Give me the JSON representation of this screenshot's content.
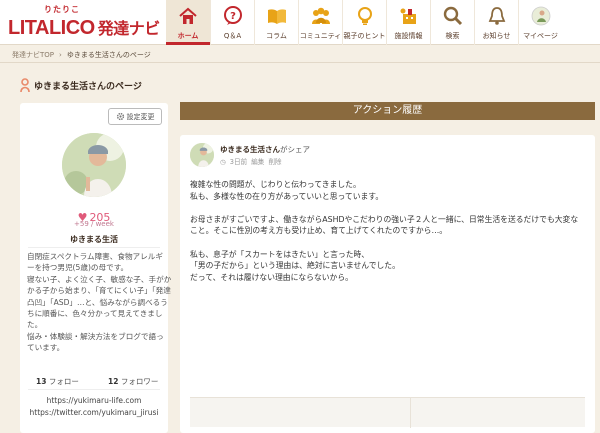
{
  "brand": {
    "ruby": "りたりこ",
    "name": "LITALICO",
    "sub": "発達ナビ",
    "accent": "#c2272d"
  },
  "nav": {
    "items": [
      {
        "label": "ホーム",
        "icon": "home-icon",
        "active": true
      },
      {
        "label": "Q＆A",
        "icon": "question-bubble-icon"
      },
      {
        "label": "コラム",
        "icon": "open-book-icon"
      },
      {
        "label": "コミュニティ",
        "icon": "community-icon"
      },
      {
        "label": "親子のヒント",
        "icon": "lightbulb-icon"
      },
      {
        "label": "施設情報",
        "icon": "facility-icon"
      },
      {
        "label": "検索",
        "icon": "search-icon"
      },
      {
        "label": "お知らせ",
        "icon": "bell-icon"
      },
      {
        "label": "マイページ",
        "icon": "user-avatar-icon"
      }
    ]
  },
  "breadcrumb": {
    "home": "発達ナビTOP",
    "current": "ゆきまる生活さんのページ"
  },
  "page": {
    "title": "ゆきまる生活さんのページ"
  },
  "profile": {
    "settings_label": "設定変更",
    "likes": "205",
    "likes_week": "+59 / week",
    "name": "ゆきまる生活",
    "bio_lines": [
      "自閉症スペクトラム障害、食物アレルギ",
      "ーを持つ男児(5歳)の母です。",
      "寝ない子、よく泣く子、敏感な子、手がか",
      "かる子から始まり、「育てにくい子」「発達",
      "凸凹」「ASD」…と、悩みながら調べるう",
      "ちに順番に、色々分かって見えてきまし",
      "た。",
      "悩み・体験談・解決方法をブログで語っ",
      "ています。"
    ],
    "follow_count": "13",
    "follow_label": "フォロー",
    "follower_count": "12",
    "follower_label": "フォロワー",
    "links": [
      "https://yukimaru-life.com",
      "https://twitter.com/yukimaru_jirusi"
    ]
  },
  "activity": {
    "section_title": "アクション履歴",
    "post": {
      "user": "ゆきまる生活さん",
      "action": "がシェア",
      "time": "3日前",
      "edit_label": "編集",
      "delete_label": "削除",
      "paragraphs": [
        [
          "複雑な性の問題が、じわりと伝わってきました。",
          "私も、多様な性の在り方があっていいと思っています。"
        ],
        [
          "お母さまがすごいですよ、働きながらASHDやこだわりの強い子２人と一緒に、日常生活を送るだけでも大変な",
          "こと。そこに性別の考え方も受け止め、育て上げてくれたのですから…。"
        ],
        [
          "私も、息子が「スカートをはきたい」と言った時、",
          "「男の子だから」という理由は、絶対に言いませんでした。",
          "だって、それは履けない理由にならないから。"
        ]
      ]
    }
  }
}
